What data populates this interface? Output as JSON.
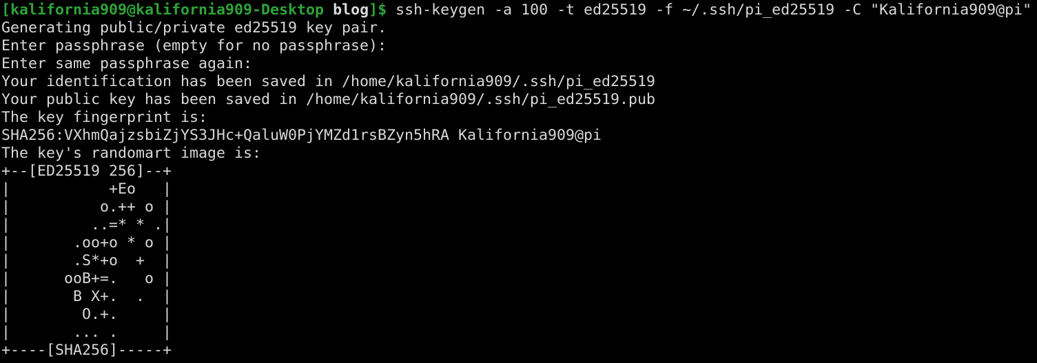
{
  "terminal": {
    "prompt": {
      "open_bracket": "[",
      "user_host": "kalifornia909@kalifornia909-Desktop",
      "cwd": "blog",
      "close_symbol": "]$"
    },
    "command": "ssh-keygen -a 100 -t ed25519 -f ~/.ssh/pi_ed25519 -C \"Kalifornia909@pi\"",
    "output_lines": [
      "Generating public/private ed25519 key pair.",
      "Enter passphrase (empty for no passphrase):",
      "Enter same passphrase again:",
      "Your identification has been saved in /home/kalifornia909/.ssh/pi_ed25519",
      "Your public key has been saved in /home/kalifornia909/.ssh/pi_ed25519.pub",
      "The key fingerprint is:",
      "SHA256:VXhmQajzsbiZjYS3JHc+QaluW0PjYMZd1rsBZyn5hRA Kalifornia909@pi",
      "The key's randomart image is:"
    ],
    "randomart": [
      "+--[ED25519 256]--+",
      "|           +Eo   |",
      "|          o.++ o |",
      "|         ..=* * .|",
      "|       .oo+o * o |",
      "|       .S*+o  +  |",
      "|      ooB+=.   o |",
      "|       B X+.  .  |",
      "|        O.+.     |",
      "|       ... .     |",
      "+----[SHA256]-----+"
    ],
    "colors": {
      "background": "#000000",
      "foreground": "#d8d8d8",
      "prompt_green": "#2fa33a"
    }
  }
}
